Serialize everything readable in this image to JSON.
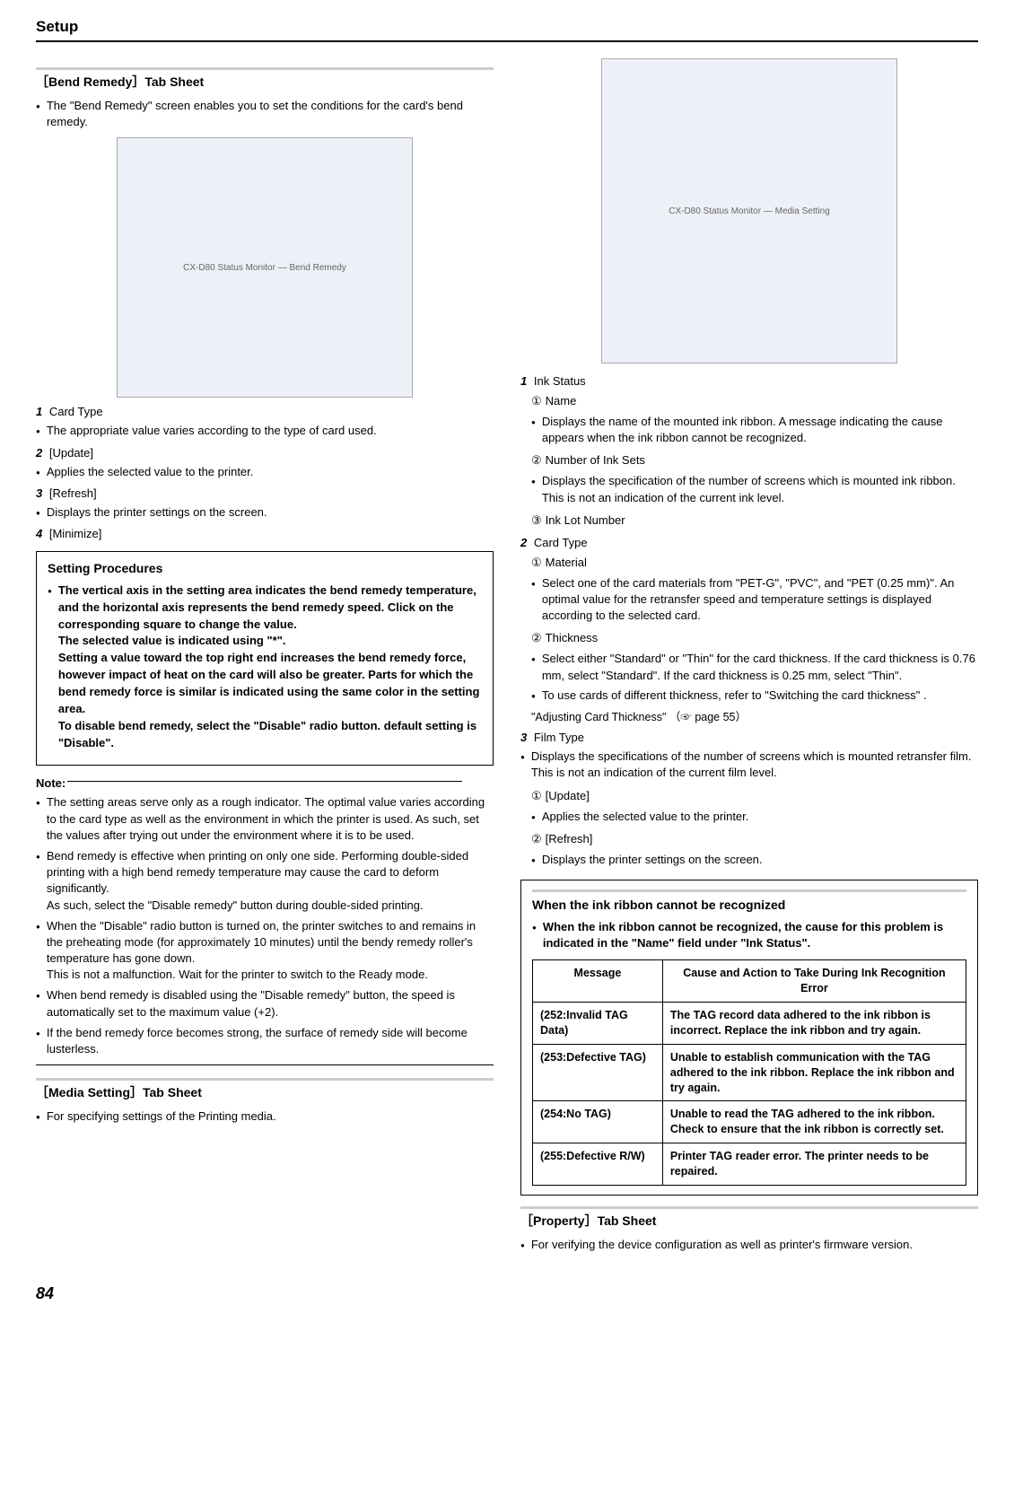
{
  "header": "Setup",
  "left": {
    "bendRemedy": {
      "title": "［Bend Remedy］Tab Sheet",
      "desc": "The \"Bend Remedy\" screen enables you to set the conditions for the card's bend remedy.",
      "imgAlt": "CX-D80 Status Monitor — Bend Remedy",
      "items": {
        "n1": "1",
        "t1": "Card Type",
        "b1": "The appropriate value varies according to the type of card used.",
        "n2": "2",
        "t2": "[Update]",
        "b2": "Applies the selected value to the printer.",
        "n3": "3",
        "t3": "[Refresh]",
        "b3": "Displays the printer settings on the screen.",
        "n4": "4",
        "t4": "[Minimize]"
      },
      "procTitle": "Setting Procedures",
      "procText": "The vertical axis in the setting area indicates the bend remedy temperature, and the horizontal axis represents the bend remedy speed. Click on the corresponding square to change the value.\nThe selected value is indicated using \"*\".\nSetting a value toward the top right end increases the bend remedy force, however impact of heat on the card will also be greater. Parts for which the bend remedy force is similar is indicated using the same color in the setting area.\nTo disable bend remedy, select the \"Disable\" radio button. default setting is \"Disable\".",
      "noteLabel": "Note:",
      "notes": {
        "n1": "The setting areas serve only as a rough indicator. The optimal value varies according to the card type as well as the environment in which the printer is used. As such, set the values after trying out under the environment where it is to be used.",
        "n2a": "Bend remedy is effective when printing on only one side. Performing double-sided printing with a high bend remedy temperature may cause the card to deform significantly.",
        "n2b": "As such, select the \"Disable remedy\" button during double-sided printing.",
        "n3a": "When the \"Disable\" radio button is turned on, the printer switches to and remains in the preheating mode (for approximately 10 minutes) until the bendy remedy roller's temperature has gone down.",
        "n3b": "This is not a malfunction. Wait for the printer to switch to the Ready mode.",
        "n4": "When bend remedy is disabled using the \"Disable remedy\" button, the speed is automatically set to the maximum value (+2).",
        "n5": "If the bend remedy force becomes strong, the surface of remedy side will become lusterless."
      }
    },
    "mediaSetting": {
      "title": "［Media Setting］Tab Sheet",
      "desc": "For specifying settings of the Printing media."
    }
  },
  "right": {
    "imgAlt": "CX-D80 Status Monitor — Media Setting",
    "ink": {
      "n1": "1",
      "t1": "Ink Status",
      "c1": "①",
      "c1t": "Name",
      "c1b": "Displays the name of the mounted ink ribbon. A message indicating the cause appears when the ink ribbon cannot be recognized.",
      "c2": "②",
      "c2t": "Number of Ink Sets",
      "c2b": "Displays the specification of the number of screens which is mounted ink ribbon. This is not an indication of the current ink level.",
      "c3": "③",
      "c3t": "Ink Lot Number"
    },
    "card": {
      "n2": "2",
      "t2": "Card Type",
      "c1": "①",
      "c1t": "Material",
      "c1b": "Select one of the card materials from \"PET-G\", \"PVC\", and \"PET (0.25 mm)\". An optimal value for the retransfer speed and temperature settings is displayed according to the selected card.",
      "c2": "②",
      "c2t": "Thickness",
      "c2b": "Select either \"Standard\" or \"Thin\" for the card thickness. If the card thickness is 0.76 mm, select \"Standard\". If the card thickness is 0.25 mm, select \"Thin\".",
      "c2c": "To use cards of different thickness, refer to \"Switching the card thickness\" .",
      "ref": "\"Adjusting Card Thickness\" （☞ page 55）"
    },
    "film": {
      "n3": "3",
      "t3": "Film Type",
      "b3": "Displays the specifications of the number of screens which is mounted retransfer film. This is not an indication of the current film level.",
      "c1": "①",
      "c1t": "[Update]",
      "c1b": "Applies the selected value to the printer.",
      "c2": "②",
      "c2t": "[Refresh]",
      "c2b": "Displays the printer settings on the screen."
    },
    "errBox": {
      "title": "When the ink ribbon cannot be recognized",
      "desc": "When the ink ribbon cannot be recognized, the cause for this problem is indicated in the \"Name\" field under \"Ink Status\".",
      "h1": "Message",
      "h2": "Cause and Action to Take During Ink Recognition Error",
      "r1m": "(252:Invalid TAG Data)",
      "r1c": "The TAG record data adhered to the ink ribbon is incorrect. Replace the ink ribbon and try again.",
      "r2m": "(253:Defective TAG)",
      "r2c": "Unable to establish communication with the TAG adhered to the ink ribbon. Replace the ink ribbon and try again.",
      "r3m": "(254:No TAG)",
      "r3c": "Unable to read the TAG adhered to the ink ribbon. Check to ensure that the ink ribbon is correctly set.",
      "r4m": "(255:Defective R/W)",
      "r4c": "Printer TAG reader error. The printer needs to be repaired."
    },
    "property": {
      "title": "［Property］Tab Sheet",
      "desc": "For verifying the device configuration as well as printer's firmware version."
    }
  },
  "pageNum": "84"
}
